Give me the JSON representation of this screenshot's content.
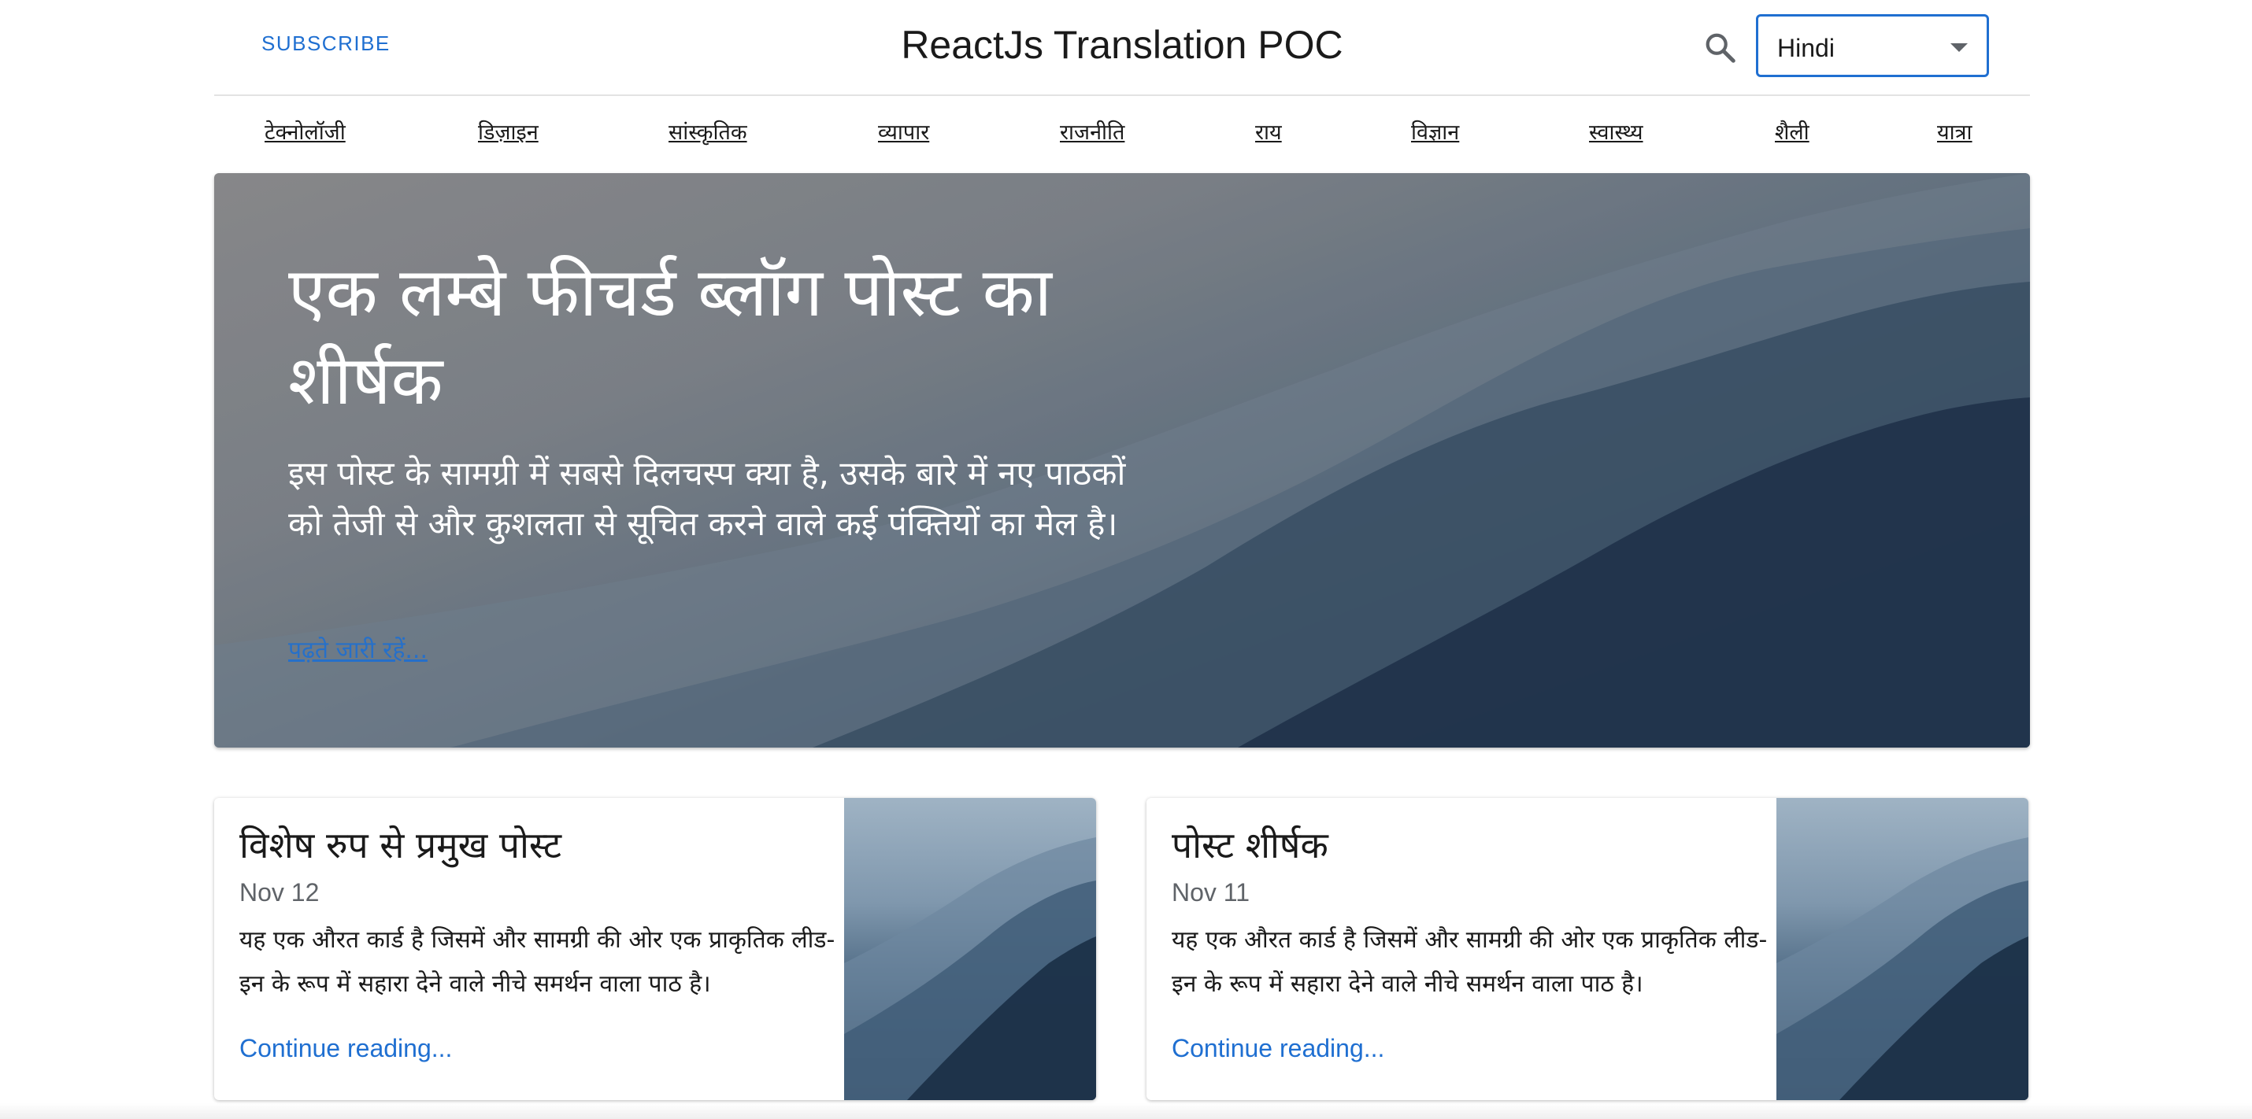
{
  "header": {
    "subscribe_label": "SUBSCRIBE",
    "title": "ReactJs Translation POC",
    "search_icon": "search-icon",
    "language_select": {
      "selected": "Hindi"
    }
  },
  "nav": {
    "items": [
      {
        "label": "टेक्नोलॉजी"
      },
      {
        "label": "डिज़ाइन"
      },
      {
        "label": "सांस्कृतिक"
      },
      {
        "label": "व्यापार"
      },
      {
        "label": "राजनीति"
      },
      {
        "label": "राय"
      },
      {
        "label": "विज्ञान"
      },
      {
        "label": "स्वास्थ्य"
      },
      {
        "label": "शैली"
      },
      {
        "label": "यात्रा"
      }
    ]
  },
  "hero": {
    "title": "एक लम्बे फीचर्ड ब्लॉग पोस्ट का शीर्षक",
    "description": "इस पोस्ट के सामग्री में सबसे दिलचस्प क्या है, उसके बारे में नए पाठकों को तेजी से और कुशलता से सूचित करने वाले कई पंक्तियों का मेल है।",
    "link_label": "पढ़ते जारी रहें..."
  },
  "cards": [
    {
      "title": "विशेष रुप से प्रमुख पोस्ट",
      "date": "Nov 12",
      "text": "यह एक औरत कार्ड है जिसमें और सामग्री की ओर एक प्राकृतिक लीड-इन के रूप में सहारा देने वाले नीचे समर्थन वाला पाठ है।",
      "link_label": "Continue reading..."
    },
    {
      "title": "पोस्ट शीर्षक",
      "date": "Nov 11",
      "text": "यह एक औरत कार्ड है जिसमें और सामग्री की ओर एक प्राकृतिक लीड-इन के रूप में सहारा देने वाले नीचे समर्थन वाला पाठ है।",
      "link_label": "Continue reading..."
    }
  ],
  "colors": {
    "accent": "#1f6fd1",
    "text": "#1a1a1a",
    "muted": "#5f6368"
  }
}
